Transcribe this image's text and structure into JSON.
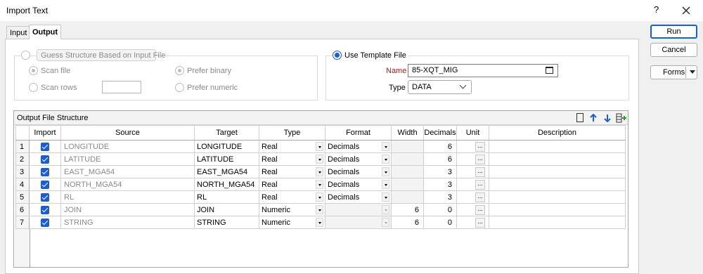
{
  "window": {
    "title": "Import Text",
    "help_label": "?"
  },
  "tabs": [
    {
      "label": "Input"
    },
    {
      "label": "Output"
    }
  ],
  "guess": {
    "button_label": "Guess Structure Based on Input File",
    "scan_file": "Scan file",
    "scan_rows": "Scan rows",
    "prefer_binary": "Prefer binary",
    "prefer_numeric": "Prefer numeric"
  },
  "template": {
    "radio_label": "Use Template File",
    "name_label": "Name",
    "name_value": "85-XQT_MIG",
    "type_label": "Type",
    "type_value": "DATA"
  },
  "buttons": {
    "run": "Run",
    "cancel": "Cancel",
    "forms": "Forms"
  },
  "grid": {
    "title": "Output File Structure",
    "columns": [
      "Import",
      "Source",
      "Target",
      "Type",
      "Format",
      "Width",
      "Decimals",
      "Unit",
      "Description"
    ],
    "rows": [
      {
        "n": "1",
        "source": "LONGITUDE",
        "target": "LONGITUDE",
        "type": "Real",
        "format": "Decimals",
        "width": "",
        "decimals": "6",
        "unit": "..."
      },
      {
        "n": "2",
        "source": "LATITUDE",
        "target": "LATITUDE",
        "type": "Real",
        "format": "Decimals",
        "width": "",
        "decimals": "6",
        "unit": "..."
      },
      {
        "n": "3",
        "source": "EAST_MGA54",
        "target": "EAST_MGA54",
        "type": "Real",
        "format": "Decimals",
        "width": "",
        "decimals": "3",
        "unit": "..."
      },
      {
        "n": "4",
        "source": "NORTH_MGA54",
        "target": "NORTH_MGA54",
        "type": "Real",
        "format": "Decimals",
        "width": "",
        "decimals": "3",
        "unit": "..."
      },
      {
        "n": "5",
        "source": "RL",
        "target": "RL",
        "type": "Real",
        "format": "Decimals",
        "width": "",
        "decimals": "3",
        "unit": "..."
      },
      {
        "n": "6",
        "source": "JOIN",
        "target": "JOIN",
        "type": "Numeric",
        "format": "",
        "width": "6",
        "decimals": "0",
        "unit": "..."
      },
      {
        "n": "7",
        "source": "STRING",
        "target": "STRING",
        "type": "Numeric",
        "format": "",
        "width": "6",
        "decimals": "0",
        "unit": "..."
      }
    ]
  }
}
